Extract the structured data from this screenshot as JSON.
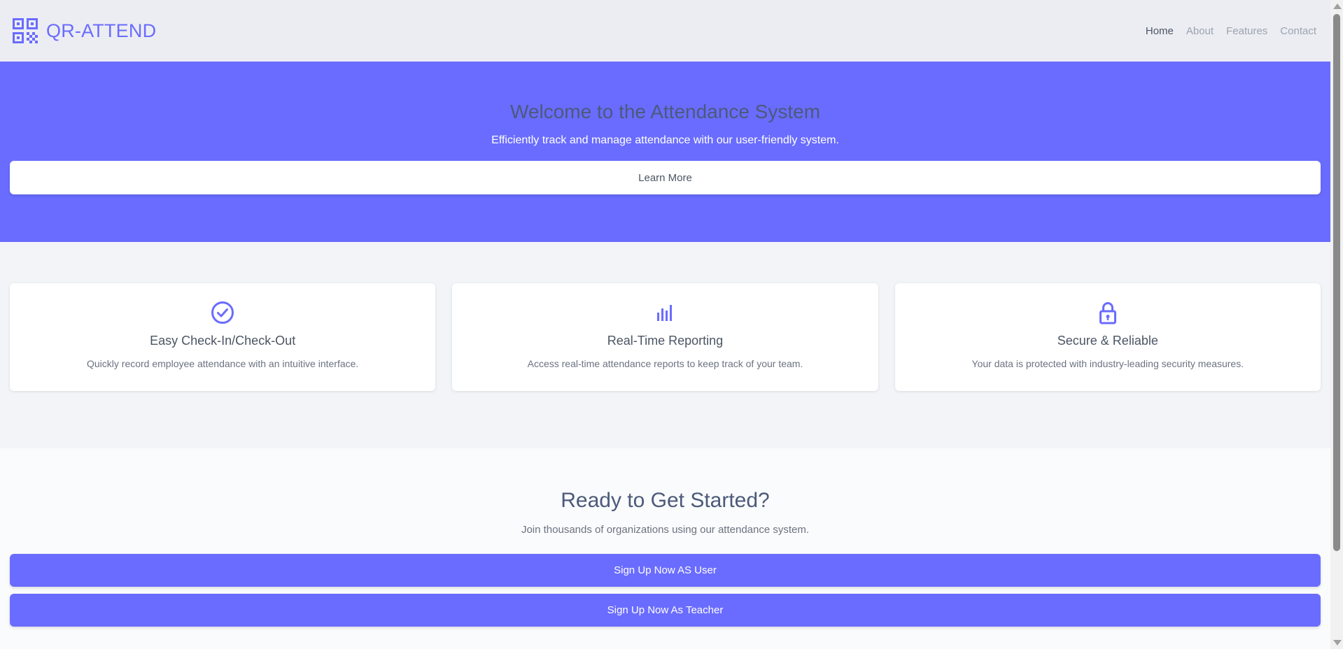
{
  "header": {
    "brand": "QR-ATTEND",
    "nav": [
      {
        "label": "Home",
        "active": true
      },
      {
        "label": "About",
        "active": false
      },
      {
        "label": "Features",
        "active": false
      },
      {
        "label": "Contact",
        "active": false
      }
    ]
  },
  "hero": {
    "title": "Welcome to the Attendance System",
    "subtitle": "Efficiently track and manage attendance with our user-friendly system.",
    "button_label": "Learn More"
  },
  "features": [
    {
      "icon": "check-circle-icon",
      "title": "Easy Check-In/Check-Out",
      "description": "Quickly record employee attendance with an intuitive interface."
    },
    {
      "icon": "bar-chart-icon",
      "title": "Real-Time Reporting",
      "description": "Access real-time attendance reports to keep track of your team."
    },
    {
      "icon": "lock-icon",
      "title": "Secure & Reliable",
      "description": "Your data is protected with industry-leading security measures."
    }
  ],
  "cta": {
    "title": "Ready to Get Started?",
    "subtitle": "Join thousands of organizations using our attendance system.",
    "user_button_label": "Sign Up Now AS User",
    "teacher_button_label": "Sign Up Now As Teacher"
  },
  "colors": {
    "accent": "#6a6cff",
    "header_bg": "#ecedf2",
    "features_bg": "#f3f4f8",
    "cta_bg": "#fafbfc"
  }
}
